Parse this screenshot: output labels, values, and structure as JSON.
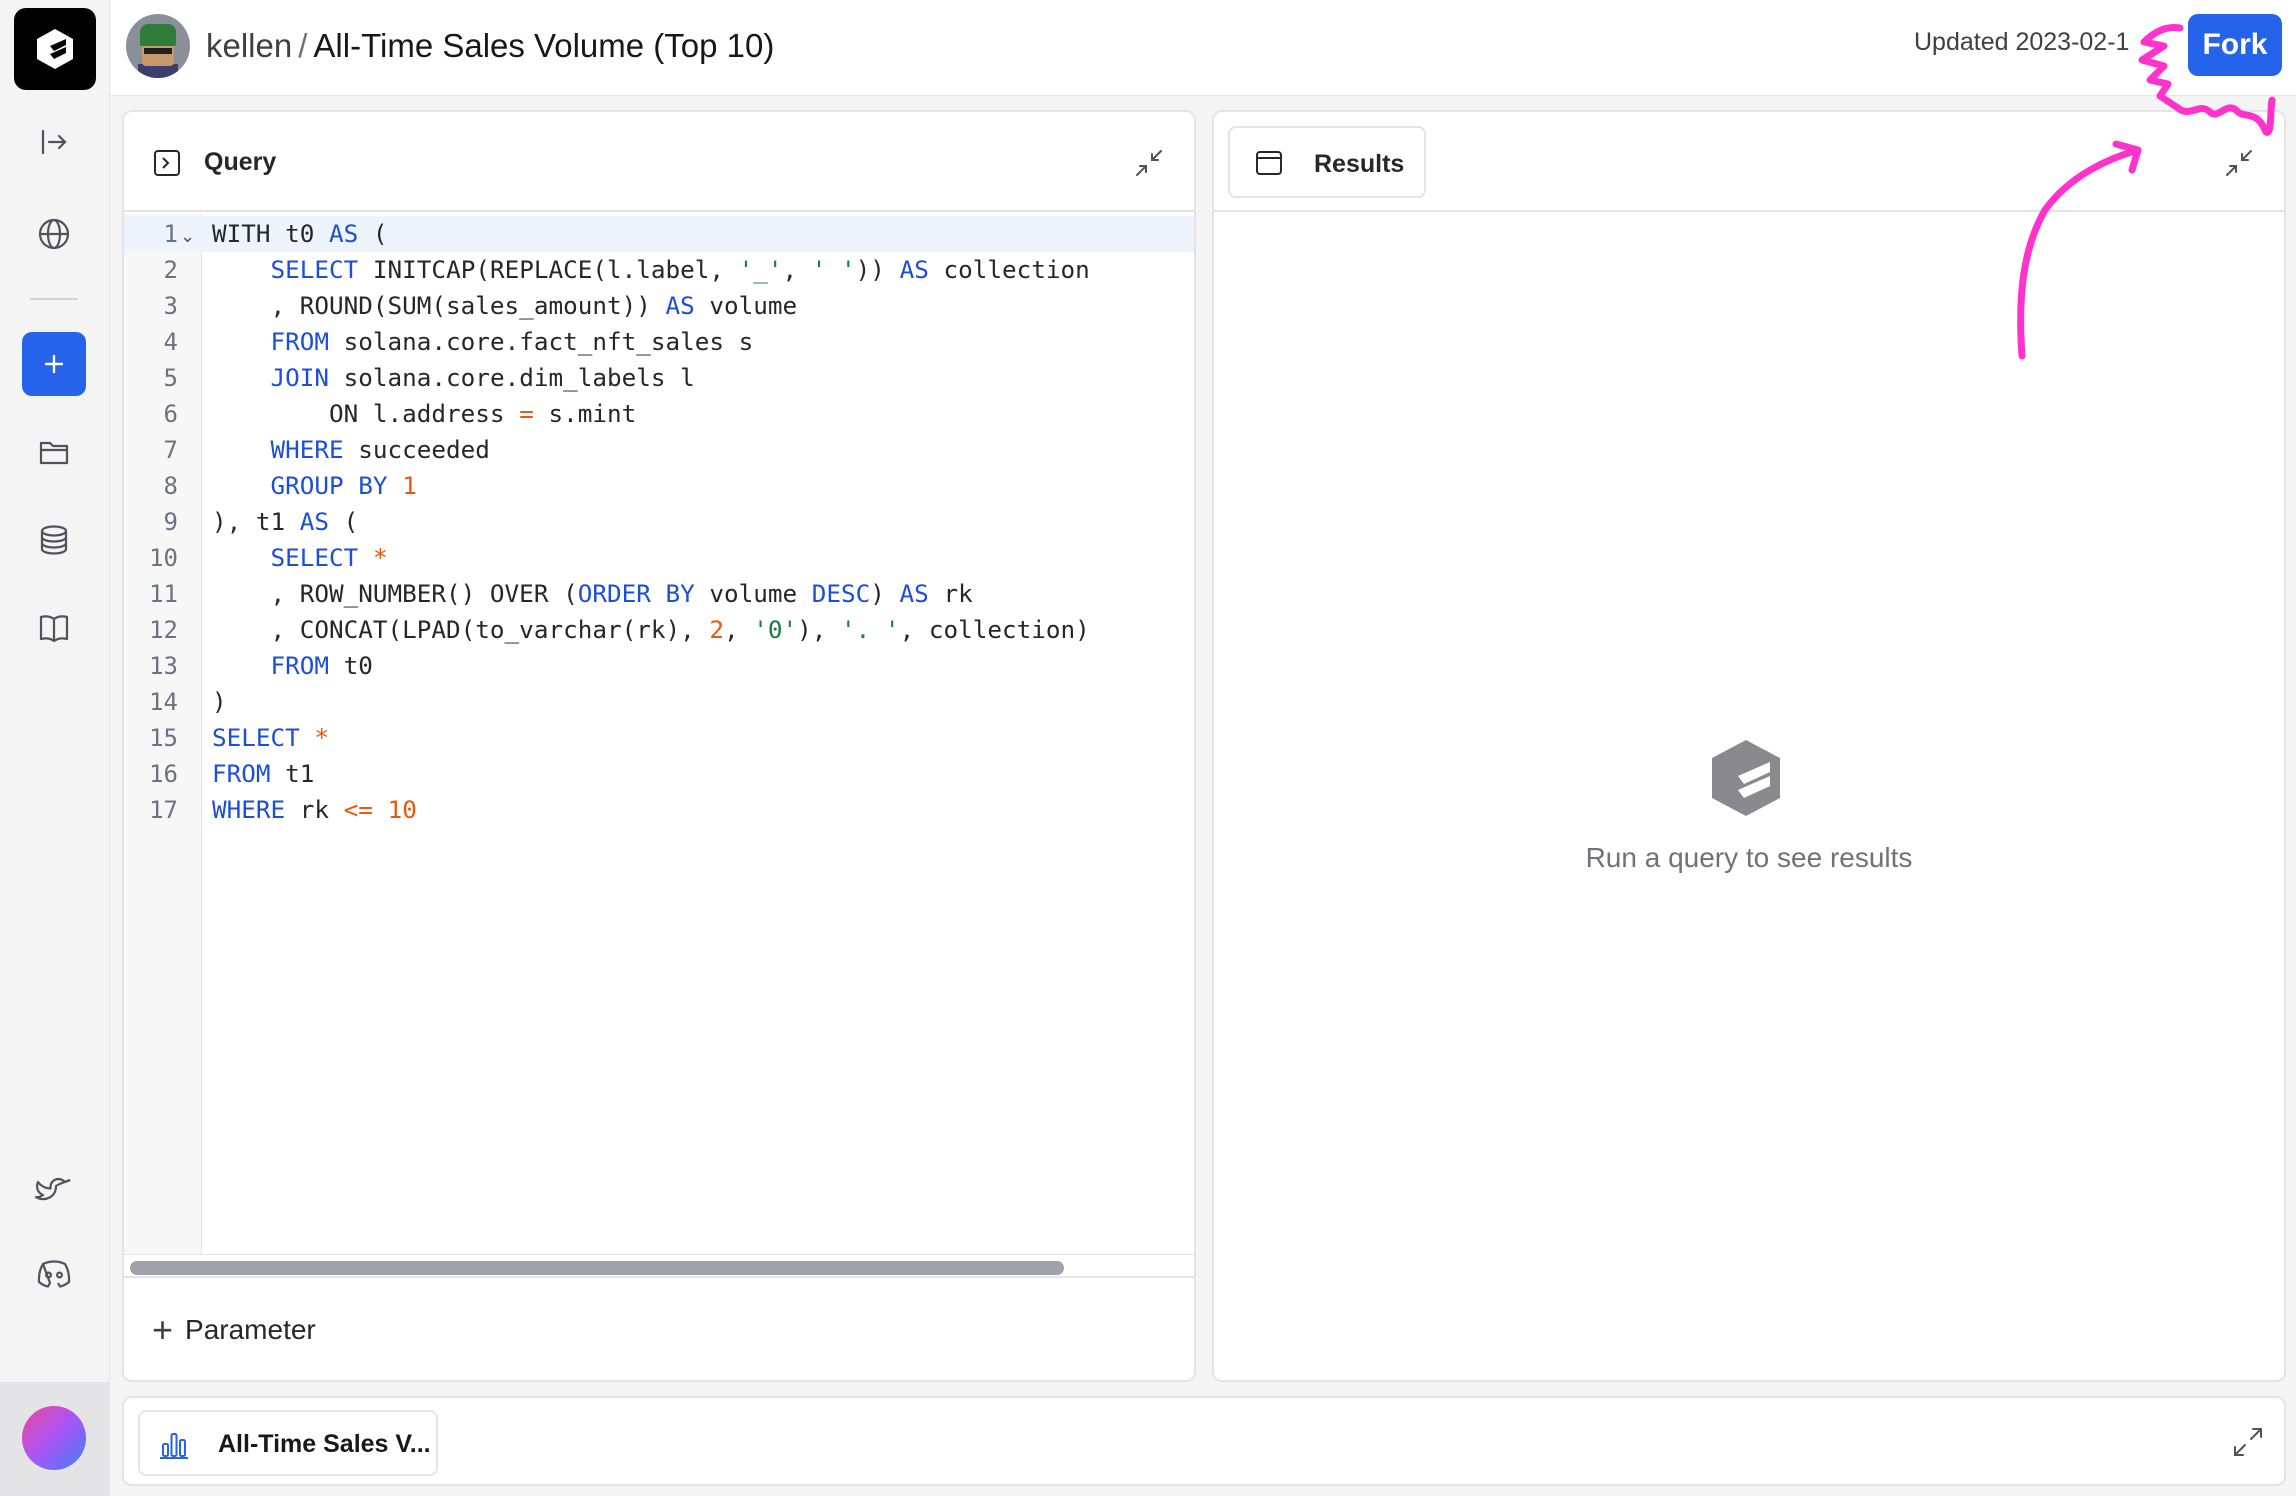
{
  "header": {
    "user": "kellen",
    "separator": "/",
    "title": "All-Time Sales Volume (Top 10)",
    "updated": "Updated 2023-02-1",
    "fork_label": "Fork"
  },
  "query_panel": {
    "label": "Query",
    "lines": [
      "1",
      "2",
      "3",
      "4",
      "5",
      "6",
      "7",
      "8",
      "9",
      "10",
      "11",
      "12",
      "13",
      "14",
      "15",
      "16",
      "17"
    ],
    "code": [
      [
        {
          "t": "WITH t0 ",
          "c": ""
        },
        {
          "t": "AS",
          "c": "kw"
        },
        {
          "t": " (",
          "c": ""
        }
      ],
      [
        {
          "t": "    ",
          "c": ""
        },
        {
          "t": "SELECT",
          "c": "kw"
        },
        {
          "t": " INITCAP(REPLACE(l.label, ",
          "c": ""
        },
        {
          "t": "'_'",
          "c": "str"
        },
        {
          "t": ", ",
          "c": ""
        },
        {
          "t": "' '",
          "c": "str"
        },
        {
          "t": ")) ",
          "c": ""
        },
        {
          "t": "AS",
          "c": "kw"
        },
        {
          "t": " collection",
          "c": ""
        }
      ],
      [
        {
          "t": "    , ROUND(SUM(sales_amount)) ",
          "c": ""
        },
        {
          "t": "AS",
          "c": "kw"
        },
        {
          "t": " volume",
          "c": ""
        }
      ],
      [
        {
          "t": "    ",
          "c": ""
        },
        {
          "t": "FROM",
          "c": "kw"
        },
        {
          "t": " solana.core.fact_nft_sales s",
          "c": ""
        }
      ],
      [
        {
          "t": "    ",
          "c": ""
        },
        {
          "t": "JOIN",
          "c": "kw"
        },
        {
          "t": " solana.core.dim_labels l",
          "c": ""
        }
      ],
      [
        {
          "t": "        ON l.address ",
          "c": ""
        },
        {
          "t": "=",
          "c": "op"
        },
        {
          "t": " s.mint",
          "c": ""
        }
      ],
      [
        {
          "t": "    ",
          "c": ""
        },
        {
          "t": "WHERE",
          "c": "kw"
        },
        {
          "t": " succeeded",
          "c": ""
        }
      ],
      [
        {
          "t": "    ",
          "c": ""
        },
        {
          "t": "GROUP BY",
          "c": "kw"
        },
        {
          "t": " ",
          "c": ""
        },
        {
          "t": "1",
          "c": "num"
        }
      ],
      [
        {
          "t": "), t1 ",
          "c": ""
        },
        {
          "t": "AS",
          "c": "kw"
        },
        {
          "t": " (",
          "c": ""
        }
      ],
      [
        {
          "t": "    ",
          "c": ""
        },
        {
          "t": "SELECT",
          "c": "kw"
        },
        {
          "t": " ",
          "c": ""
        },
        {
          "t": "*",
          "c": "op"
        }
      ],
      [
        {
          "t": "    , ROW_NUMBER() OVER (",
          "c": ""
        },
        {
          "t": "ORDER BY",
          "c": "kw"
        },
        {
          "t": " volume ",
          "c": ""
        },
        {
          "t": "DESC",
          "c": "kw"
        },
        {
          "t": ") ",
          "c": ""
        },
        {
          "t": "AS",
          "c": "kw"
        },
        {
          "t": " rk",
          "c": ""
        }
      ],
      [
        {
          "t": "    , CONCAT(LPAD(to_varchar(rk), ",
          "c": ""
        },
        {
          "t": "2",
          "c": "num"
        },
        {
          "t": ", ",
          "c": ""
        },
        {
          "t": "'0'",
          "c": "str"
        },
        {
          "t": "), ",
          "c": ""
        },
        {
          "t": "'. '",
          "c": "str"
        },
        {
          "t": ", collection)",
          "c": ""
        }
      ],
      [
        {
          "t": "    ",
          "c": ""
        },
        {
          "t": "FROM",
          "c": "kw"
        },
        {
          "t": " t0",
          "c": ""
        }
      ],
      [
        {
          "t": ")",
          "c": ""
        }
      ],
      [
        {
          "t": "SELECT",
          "c": "kw"
        },
        {
          "t": " ",
          "c": ""
        },
        {
          "t": "*",
          "c": "op"
        }
      ],
      [
        {
          "t": "FROM",
          "c": "kw"
        },
        {
          "t": " t1",
          "c": ""
        }
      ],
      [
        {
          "t": "WHERE",
          "c": "kw"
        },
        {
          "t": " rk ",
          "c": ""
        },
        {
          "t": "<=",
          "c": "op"
        },
        {
          "t": " ",
          "c": ""
        },
        {
          "t": "10",
          "c": "num"
        }
      ]
    ],
    "parameter_label": "Parameter"
  },
  "results_panel": {
    "tab_label": "Results",
    "empty_message": "Run a query to see results"
  },
  "bottom_tabs": {
    "chart_tab_label": "All-Time Sales V..."
  },
  "sidebar": {
    "icons": [
      "logo-icon",
      "collapse-sidebar-icon",
      "globe-icon",
      "new-plus-icon",
      "folder-icon",
      "database-icon",
      "book-icon",
      "twitter-icon",
      "discord-icon",
      "user-avatar"
    ]
  },
  "colors": {
    "accent": "#2563eb",
    "keyword": "#1d4ed8",
    "number": "#ea580c",
    "string": "#15803d",
    "annotation": "#ff33cc"
  }
}
